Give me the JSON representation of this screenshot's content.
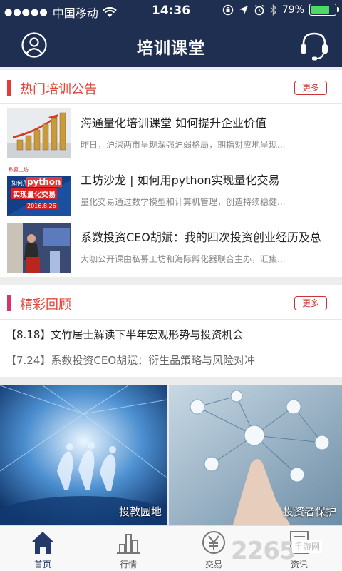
{
  "status_bar": {
    "carrier": "中国移动",
    "time": "14:36",
    "battery": "79%",
    "battery_level": 0.79
  },
  "header": {
    "title": "培训课堂"
  },
  "hot_section": {
    "title": "热门培训公告",
    "more": "更多",
    "accent": "#e53a3a",
    "items": [
      {
        "title": "海通量化培训课堂  如何提升企业价值",
        "desc": "昨日，沪深两市呈现深强沪弱格局，期指对应地呈现..."
      },
      {
        "title": "工坊沙龙 | 如何用python实现量化交易",
        "desc": "量化交易通过数学模型和计算机管理，创造持续稳健..."
      },
      {
        "title": "系数投资CEO胡斌：我的四次投资创业经历及总",
        "desc": "大咖公开课由私募工坊和海际孵化器联合主办，汇集..."
      }
    ],
    "thumb2_text": {
      "line1": "如何用",
      "brand": "python",
      "line2": "实现量化交易",
      "date": "2016.8.26",
      "corner": "私募工坊"
    }
  },
  "review_section": {
    "title": "精彩回顾",
    "more": "更多",
    "accent": "#d9336a",
    "items": [
      "【8.18】文竹居士解读下半年宏观形势与投资机会",
      "【7.24】系数投资CEO胡斌：衍生品策略与风险对冲"
    ]
  },
  "banners": [
    {
      "label": "投教园地"
    },
    {
      "label": "投资者保护"
    }
  ],
  "tabbar": {
    "tabs": [
      {
        "label": "首页",
        "icon": "home-icon",
        "active": true
      },
      {
        "label": "行情",
        "icon": "chart-icon"
      },
      {
        "label": "交易",
        "icon": "yen-icon"
      },
      {
        "label": "资讯",
        "icon": "news-icon"
      }
    ]
  },
  "watermark": {
    "big": "2265",
    "small": "手游网"
  },
  "colors": {
    "nav": "#1e2f52",
    "tab_active": "#233a6a"
  }
}
